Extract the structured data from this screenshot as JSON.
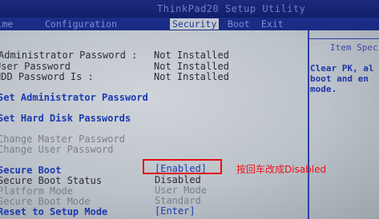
{
  "window": {
    "title": "ThinkPad20 Setup Utility"
  },
  "tabs": [
    {
      "label": "Date/Time"
    },
    {
      "label": "Configuration"
    },
    {
      "label": "Security"
    },
    {
      "label": "Boot"
    },
    {
      "label": "Exit"
    }
  ],
  "passwords": [
    {
      "label": "Administrator Password :",
      "value": "Not Installed"
    },
    {
      "label": "User Password",
      "value": "Not Installed"
    },
    {
      "label": "HDD Password Is :",
      "value": "Not Installed"
    }
  ],
  "actions": {
    "set_admin_password": "Set Administrator Password",
    "set_hdd_passwords": "Set Hard Disk Passwords",
    "change_master_password": "Change Master Password",
    "change_user_password": "Change User Password"
  },
  "secure_boot": [
    {
      "label": "Secure Boot",
      "value": "[Enabled]"
    },
    {
      "label": "Secure Boot Status",
      "value": "Disabled"
    },
    {
      "label": "Platform Mode",
      "value": "User Mode"
    },
    {
      "label": "Secure Boot Mode",
      "value": "Standard"
    },
    {
      "label": "Reset to Setup Mode",
      "value": "[Enter]"
    }
  ],
  "help_panel": {
    "title": "Item Spec",
    "lines": [
      "Clear PK, al",
      "boot and en",
      "mode."
    ]
  },
  "annotation": {
    "text": "按回车改成Disabled",
    "color": "#e8141a"
  },
  "colors": {
    "header_bg": "#1b2a7a",
    "body_bg": "#c3c8cf",
    "accent_blue": "#1c3ab0",
    "highlight_red": "#e01010"
  }
}
